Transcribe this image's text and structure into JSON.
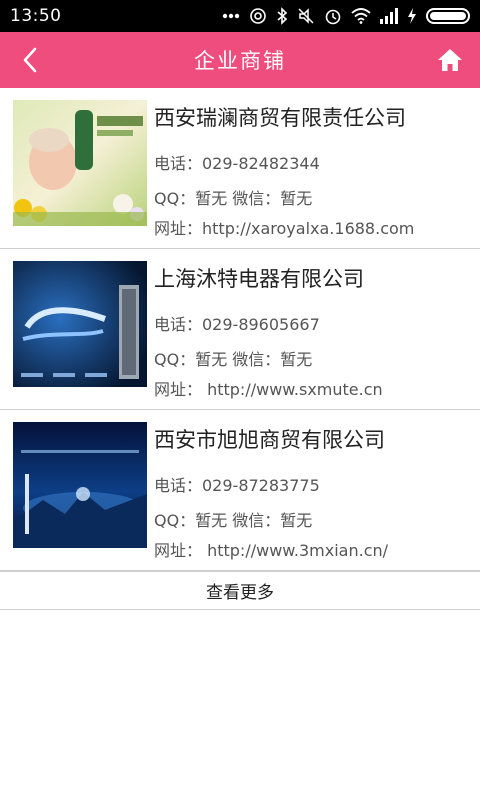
{
  "status": {
    "time": "13:50",
    "icons": [
      "more-dots-icon",
      "hotspot-icon",
      "bluetooth-icon",
      "mute-icon",
      "alarm-icon",
      "wifi-icon",
      "signal-icon",
      "charging-icon",
      "battery-icon"
    ]
  },
  "header": {
    "title": "企业商铺",
    "back_icon": "chevron-left-icon",
    "home_icon": "home-icon",
    "background": "#ee4d7e"
  },
  "shops": [
    {
      "name": "西安瑞澜商贸有限责任公司",
      "phone": "电话：029-82482344",
      "social": "QQ：暂无   微信：暂无",
      "website": "网址：http://xaroyalxa.1688.com"
    },
    {
      "name": "上海沐特电器有限公司",
      "phone": "电话：029-89605667",
      "social": "QQ：暂无   微信：暂无",
      "website": "网址： http://www.sxmute.cn"
    },
    {
      "name": "西安市旭旭商贸有限公司",
      "phone": "电话：029-87283775",
      "social": "QQ：暂无   微信：暂无",
      "website": "网址： http://www.3mxian.cn/"
    }
  ],
  "more_label": "查看更多"
}
